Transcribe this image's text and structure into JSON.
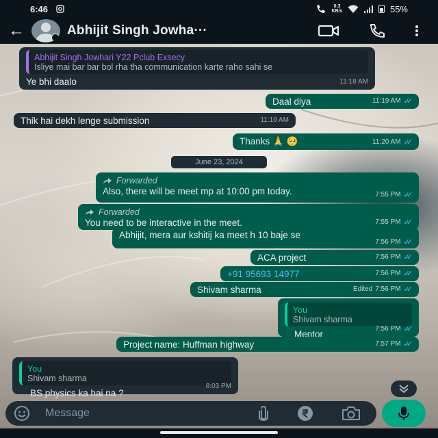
{
  "status_bar": {
    "time": "6:46",
    "speed_value": "0.3",
    "speed_unit": "KB/s",
    "battery": "55%"
  },
  "header": {
    "contact_name": "Abhijit Singh Jowha···",
    "icons": [
      "back-arrow-icon",
      "video-call-icon",
      "voice-call-icon",
      "more-options-icon"
    ]
  },
  "messages": [
    {
      "direction": "in",
      "quote_name": "Abhijit Singh Jowhari Y22 Pclub Exsecy",
      "quote_text": "Isliye mai bar bar bol rha tha communication karte raho sahi se",
      "text": "Ye bhi daalo",
      "time": "11:18 AM"
    },
    {
      "direction": "out",
      "text": "Daal diya",
      "time": "11:19 AM"
    },
    {
      "direction": "in",
      "text": "Thik hai dekh lenge submission",
      "time": "11:19 AM"
    },
    {
      "direction": "out",
      "text": "Thanks 🙏 🥺",
      "time": "11:20 AM"
    },
    {
      "direction": "out",
      "forwarded": "Forwarded",
      "text": "Also, there will be meet mp at 10:00 pm today.",
      "time": "7:55 PM"
    },
    {
      "direction": "out",
      "forwarded": "Forwarded",
      "text": "You need to be interactive in the meet.",
      "time": "7:55 PM"
    },
    {
      "direction": "out",
      "text": "Abhijit, mera aur kshitij ka meet h 10 baje se",
      "time": "7:56 PM"
    },
    {
      "direction": "out",
      "text": "ACA project",
      "time": "7:56 PM"
    },
    {
      "direction": "out",
      "text": "+91 95693 14977",
      "time": "7:56 PM"
    },
    {
      "direction": "out",
      "text": "Shivam sharma",
      "edited": "Edited",
      "time": "7:56 PM"
    },
    {
      "direction": "out",
      "quote_name": "You",
      "quote_text": "Shivam sharma",
      "text": "Mentor",
      "time": "7:56 PM"
    },
    {
      "direction": "out",
      "text": "Project name:  Huffman highway",
      "time": "7:57 PM"
    },
    {
      "direction": "in",
      "quote_name": "You",
      "quote_text": "Shivam sharma",
      "text": "BS physics ka hai na ?",
      "time": "8:03 PM"
    }
  ],
  "date_chip": "June 23, 2024",
  "input": {
    "placeholder": "Message",
    "icons": [
      "emoji-icon",
      "attach-icon",
      "rupee-payment-icon",
      "camera-icon",
      "mic-icon"
    ]
  },
  "colors": {
    "incoming_bubble": "#1f2c34",
    "outgoing_bubble": "#005c4b",
    "accent_green": "#00a884",
    "read_ticks": "#53bdeb",
    "quote_purple": "#a472e8"
  }
}
